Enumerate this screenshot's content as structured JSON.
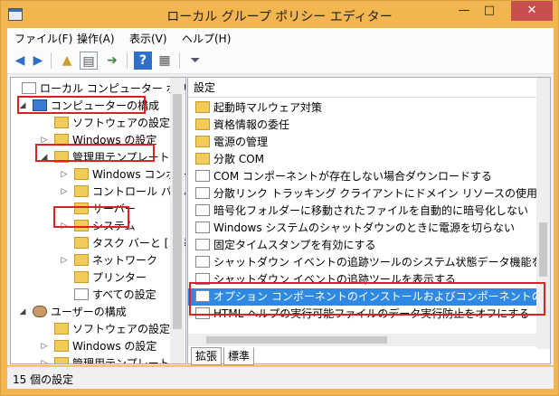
{
  "window": {
    "title": "ローカル グループ ポリシー エディター",
    "min": "—",
    "max": "□",
    "close": "✕"
  },
  "menu": [
    "ファイル(F)",
    "操作(A)",
    "表示(V)",
    "ヘルプ(H)"
  ],
  "toolbar_icons": [
    "back-arrow-icon",
    "forward-arrow-icon",
    "folder-up-icon",
    "show-tree-icon",
    "export-icon",
    "help-icon",
    "properties-icon",
    "filter-icon"
  ],
  "tree": {
    "root": "ローカル コンピューター ポリシー",
    "computer_config": "コンピューターの構成",
    "software_settings": "ソフトウェアの設定",
    "windows_settings": "Windows の設定",
    "admin_templates": "管理用テンプレート",
    "windows_components": "Windows コンポーネ",
    "control_panel": "コントロール パネル",
    "server": "サーバー",
    "system": "システム",
    "taskbar": "タスク バーと [スター",
    "network": "ネットワーク",
    "printers": "プリンター",
    "all_settings": "すべての設定",
    "user_config": "ユーザーの構成",
    "user_software": "ソフトウェアの設定",
    "user_windows": "Windows の設定",
    "user_admin": "管理用テンプレート"
  },
  "right": {
    "header": "設定",
    "items": [
      {
        "label": "起動時マルウェア対策",
        "type": "folder"
      },
      {
        "label": "資格情報の委任",
        "type": "folder"
      },
      {
        "label": "電源の管理",
        "type": "folder"
      },
      {
        "label": "分散 COM",
        "type": "folder"
      },
      {
        "label": "COM コンポーネントが存在しない場合ダウンロードする",
        "type": "setting"
      },
      {
        "label": "分散リンク トラッキング クライアントにドメイン リソースの使用を許可する",
        "type": "setting"
      },
      {
        "label": "暗号化フォルダーに移動されたファイルを自動的に暗号化しない",
        "type": "setting"
      },
      {
        "label": "Windows システムのシャットダウンのときに電源を切らない",
        "type": "setting"
      },
      {
        "label": "固定タイムスタンプを有効にする",
        "type": "setting"
      },
      {
        "label": "シャットダウン イベントの追跡ツールのシステム状態データ機能をアク...",
        "type": "setting"
      },
      {
        "label": "シャットダウン イベントの追跡ツールを表示する",
        "type": "setting"
      },
      {
        "label": "オプション コンポーネントのインストールおよびコンポーネントの修復の...",
        "type": "setting"
      },
      {
        "label": "HTML ヘルプの実行可能ファイルのデータ実行防止をオフにする",
        "type": "setting"
      }
    ]
  },
  "tabs": [
    "拡張",
    "標準"
  ],
  "status": "15 個の設定"
}
